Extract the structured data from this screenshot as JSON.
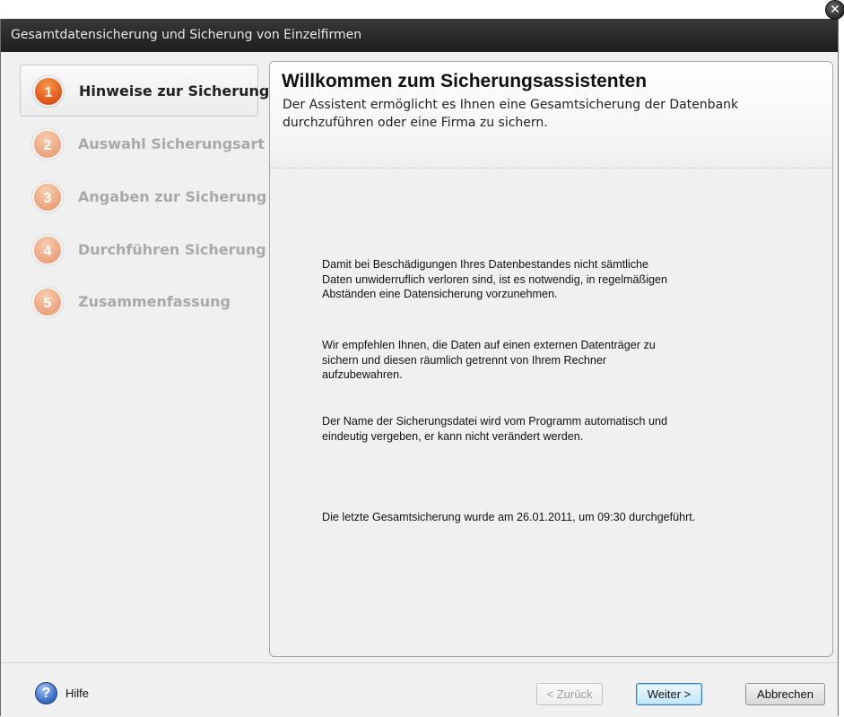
{
  "window": {
    "title": "Gesamtdatensicherung und Sicherung von Einzelfirmen",
    "close_label": "✕"
  },
  "steps": [
    {
      "number": "1",
      "label": "Hinweise zur Sicherung",
      "active": true
    },
    {
      "number": "2",
      "label": "Auswahl Sicherungsart",
      "active": false
    },
    {
      "number": "3",
      "label": "Angaben zur Sicherung",
      "active": false
    },
    {
      "number": "4",
      "label": "Durchführen Sicherung",
      "active": false
    },
    {
      "number": "5",
      "label": "Zusammenfassung",
      "active": false
    }
  ],
  "panel": {
    "title": "Willkommen zum Sicherungsassistenten",
    "subtitle": "Der Assistent ermöglicht es Ihnen eine Gesamtsicherung der Datenbank durchzuführen oder eine Firma zu sichern.",
    "paragraphs": [
      "Damit bei Beschädigungen Ihres Datenbestandes nicht sämtliche Daten unwiderruflich verloren sind, ist es notwendig, in regelmäßigen Abständen eine Datensicherung vorzunehmen.",
      "Wir empfehlen Ihnen, die Daten auf einen externen Datenträger zu sichern und diesen räumlich getrennt von Ihrem Rechner aufzubewahren.",
      "Der Name der Sicherungsdatei wird vom Programm automatisch und eindeutig vergeben, er kann nicht verändert werden.",
      "Die letzte Gesamtsicherung wurde am 26.01.2011, um 09:30 durchgeführt."
    ]
  },
  "footer": {
    "help_icon_glyph": "?",
    "help_label": "Hilfe",
    "back_label": "< Zurück",
    "next_label": "Weiter >",
    "cancel_label": "Abbrechen"
  },
  "colors": {
    "active_step": "#e0561a",
    "inactive_step": "#eaa27c",
    "titlebar": "#2a2a2a"
  }
}
